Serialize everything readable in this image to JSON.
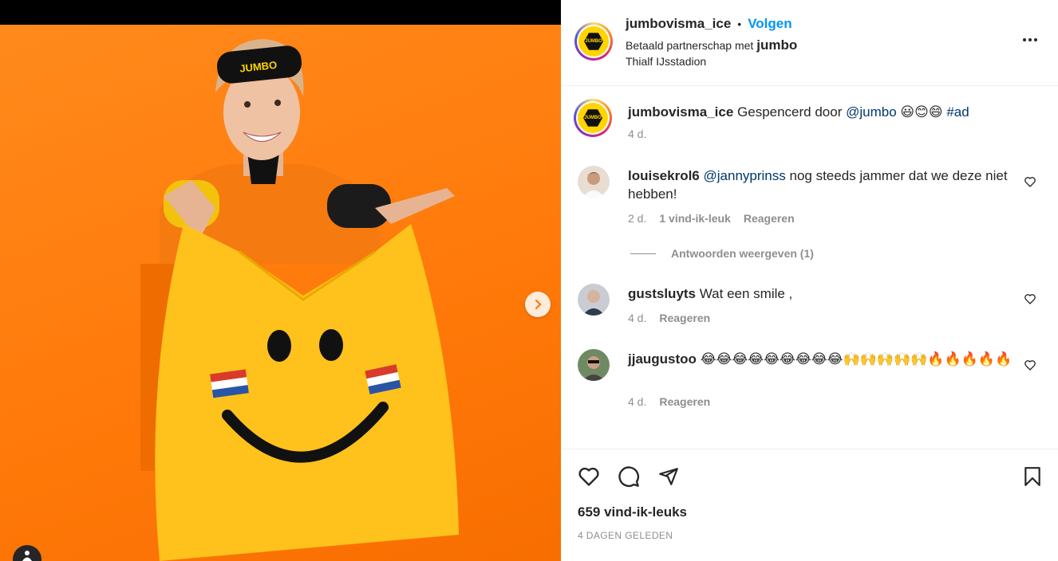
{
  "post": {
    "author": "jumbovisma_ice",
    "follow_label": "Volgen",
    "partnership_prefix": "Betaald partnerschap met",
    "partner": "jumbo",
    "location": "Thialf IJsstadion",
    "logo_text": "JUMBO"
  },
  "caption": {
    "author": "jumbovisma_ice",
    "text": "Gespencerd door",
    "mention": "@jumbo",
    "emojis": "😃😊😄",
    "hashtag": "#ad",
    "time": "4 d."
  },
  "comments": [
    {
      "author": "louisekrol6",
      "mention": "@jannyprinss",
      "text": "nog steeds jammer dat we deze niet hebben!",
      "time": "2 d.",
      "likes": "1 vind-ik-leuk",
      "reply_label": "Reageren",
      "view_replies": "Antwoorden weergeven (1)"
    },
    {
      "author": "gustsluyts",
      "text": "Wat een smile ,",
      "time": "4 d.",
      "reply_label": "Reageren"
    },
    {
      "author": "jjaugustoo",
      "text": "😂😂😂😂😂😂😂😂😂🙌🙌🙌🙌🙌🔥🔥🔥🔥🔥",
      "time": "4 d.",
      "reply_label": "Reageren"
    }
  ],
  "footer": {
    "likes": "659 vind-ik-leuks",
    "date": "4 DAGEN GELEDEN"
  },
  "colors": {
    "accent_blue": "#0095f6",
    "link": "#00376b",
    "muted": "#8e8e8e",
    "photo_bg": "#ff7a0a"
  },
  "icons": [
    "heart-icon",
    "comment-icon",
    "share-icon",
    "bookmark-icon",
    "chevron-right-icon",
    "more-icon",
    "user-tag-icon"
  ]
}
